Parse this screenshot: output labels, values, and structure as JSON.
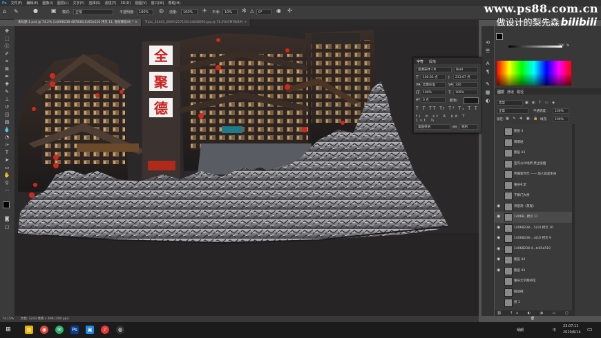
{
  "menu": [
    "文件(F)",
    "编辑(E)",
    "图像(I)",
    "图层(L)",
    "文字(Y)",
    "选择(S)",
    "滤镜(T)",
    "3D(D)",
    "视图(V)",
    "窗口(W)",
    "帮助(H)"
  ],
  "watermark": {
    "site": "www.ps88.com.cn",
    "author": "做设计的梨先森",
    "bilibili": "bilibili"
  },
  "options": {
    "mode_label": "模式:",
    "mode_value": "正常",
    "opacity_label": "不透明度:",
    "opacity_value": "100%",
    "flow_label": "流量:",
    "flow_value": "100%",
    "smooth_label": "平滑:",
    "smooth_value": "10%",
    "angle_value": "0°"
  },
  "tabs": [
    {
      "label": "未标题-1.psd @ 74.2% (14068238-4878d6c5d65a510 拷贝 11, 图层蒙版/8) *"
    },
    {
      "label": "Tripic_22443_20091217150144046693.jpg @ 71.5%(CMYK/8#)"
    }
  ],
  "status": {
    "zoom": "74.15%",
    "doc": "文档: 3243 像素 x 496 (300 ppi)"
  },
  "character": {
    "tab1": "字符",
    "tab2": "段落",
    "font": "思源宋体 CN",
    "style": "Bold",
    "size": "102.92 点",
    "leading": "213.67 点",
    "kerning": "度量标准",
    "tracking": "320",
    "vscale": "100%",
    "hscale": "100%",
    "baseline": "0 点",
    "color_label": "颜色:",
    "lang": "美国英语",
    "aa": "锐利"
  },
  "layers_panel": {
    "tab1": "图层",
    "tab2": "通道",
    "tab3": "路径",
    "filter": "类型",
    "blend": "正常",
    "opacity_label": "不透明度:",
    "opacity": "100%",
    "lock_label": "锁定:",
    "fill_label": "填充:",
    "fill": "100%",
    "items": [
      {
        "name": "图层 4",
        "eye": false
      },
      {
        "name": "萌萌哒",
        "eye": false
      },
      {
        "name": "图层 43",
        "eye": false
      },
      {
        "name": "室内公众场所 禁止吸烟",
        "eye": false
      },
      {
        "name": "传播新时代 —— 助人就是生命",
        "eye": false
      },
      {
        "name": "重庆礼堂",
        "eye": false
      },
      {
        "name": "千厮门大桥",
        "eye": false
      },
      {
        "name": "洪崖洞（景观）",
        "eye": true
      },
      {
        "name": "14068...拷贝 11",
        "eye": true
      },
      {
        "name": "14068238-...5(10 拷贝 10",
        "eye": true
      },
      {
        "name": "14068238-...d(10 拷贝 9",
        "eye": true
      },
      {
        "name": "14068238-4...tc65a510",
        "eye": true
      },
      {
        "name": "图层 44",
        "eye": true
      },
      {
        "name": "图层 43",
        "eye": true
      },
      {
        "name": "重庆大学图书馆",
        "eye": false
      },
      {
        "name": "解放碑",
        "eye": false
      },
      {
        "name": "组 1",
        "eye": false
      }
    ]
  },
  "color_values": {
    "fg": "#000000",
    "bg": "#ffffff",
    "slider_value": "100",
    "slider_unit": "%"
  },
  "taskbar": {
    "time": "23:07:11",
    "date": "2020/6/14",
    "weather": "晴朗",
    "lang": "中"
  }
}
